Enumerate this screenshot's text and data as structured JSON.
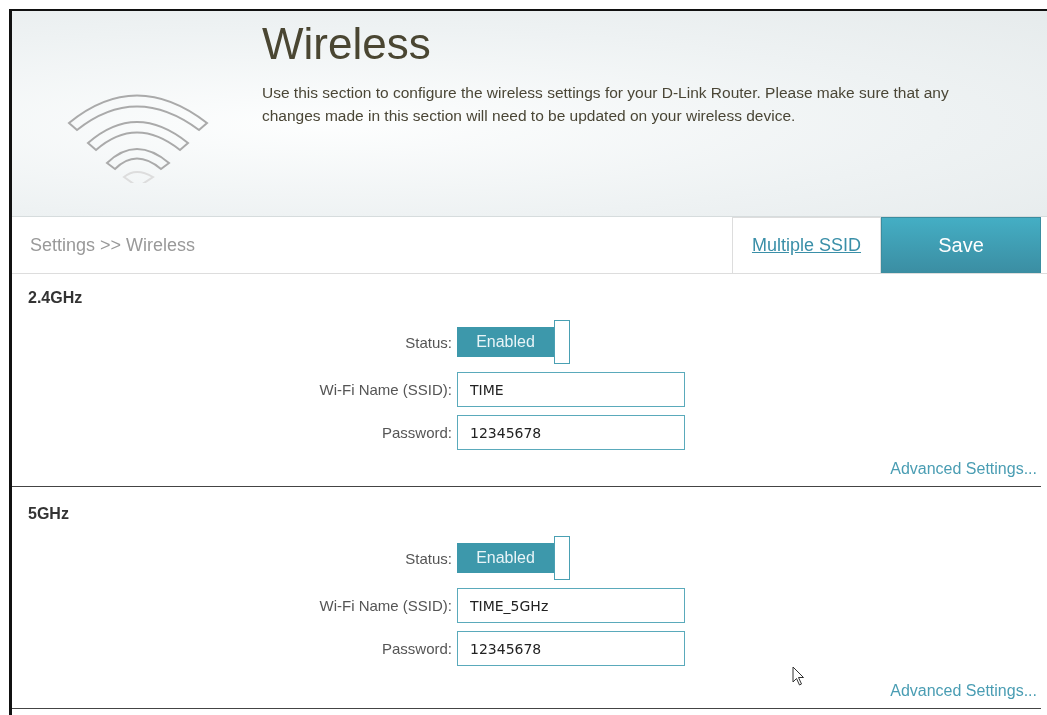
{
  "header": {
    "title": "Wireless",
    "description": "Use this section to configure the wireless settings for your D-Link Router. Please make sure that any changes made in this section will need to be updated on your wireless device."
  },
  "breadcrumb": "Settings >> Wireless",
  "actions": {
    "link": "Multiple SSID",
    "save": "Save"
  },
  "bands": [
    {
      "title": "2.4GHz",
      "status_label": "Status:",
      "status": {
        "label": "Enabled",
        "on": true
      },
      "ssid_label": "Wi-Fi Name (SSID):",
      "ssid": "TIME",
      "password_label": "Password:",
      "password": "12345678",
      "advanced": "Advanced Settings..."
    },
    {
      "title": "5GHz",
      "status_label": "Status:",
      "status": {
        "label": "Enabled",
        "on": true
      },
      "ssid_label": "Wi-Fi Name (SSID):",
      "ssid": "TIME_5GHz",
      "password_label": "Password:",
      "password": "12345678",
      "advanced": "Advanced Settings..."
    }
  ]
}
